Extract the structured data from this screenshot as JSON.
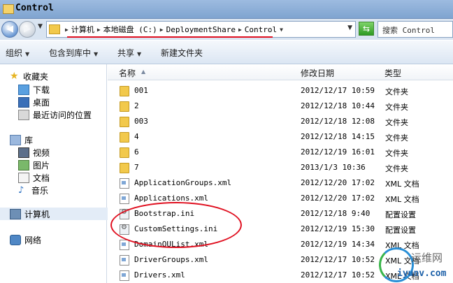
{
  "window": {
    "title": "Control"
  },
  "address": {
    "crumbs": [
      "计算机",
      "本地磁盘 (C:)",
      "DeploymentShare",
      "Control"
    ],
    "search_placeholder": "搜索 Control"
  },
  "toolbar": {
    "organize": "组织",
    "include_library": "包含到库中",
    "share": "共享",
    "new_folder": "新建文件夹"
  },
  "nav": {
    "favorites": {
      "label": "收藏夹",
      "items": [
        "下载",
        "桌面",
        "最近访问的位置"
      ]
    },
    "libraries": {
      "label": "库",
      "items": [
        "视频",
        "图片",
        "文档",
        "音乐"
      ]
    },
    "computer": "计算机",
    "network": "网络"
  },
  "columns": {
    "name": "名称",
    "date": "修改日期",
    "type": "类型"
  },
  "files": [
    {
      "name": "001",
      "date": "2012/12/17 10:59",
      "type": "文件夹",
      "icon": "folder-icon"
    },
    {
      "name": "2",
      "date": "2012/12/18 10:44",
      "type": "文件夹",
      "icon": "folder-icon"
    },
    {
      "name": "003",
      "date": "2012/12/18 12:08",
      "type": "文件夹",
      "icon": "folder-icon"
    },
    {
      "name": "4",
      "date": "2012/12/18 14:15",
      "type": "文件夹",
      "icon": "folder-icon"
    },
    {
      "name": "6",
      "date": "2012/12/19 16:01",
      "type": "文件夹",
      "icon": "folder-icon"
    },
    {
      "name": "7",
      "date": "2013/1/3 10:36",
      "type": "文件夹",
      "icon": "folder-icon"
    },
    {
      "name": "ApplicationGroups.xml",
      "date": "2012/12/20 17:02",
      "type": "XML 文档",
      "icon": "xml-file-icon"
    },
    {
      "name": "Applications.xml",
      "date": "2012/12/20 17:02",
      "type": "XML 文档",
      "icon": "xml-file-icon"
    },
    {
      "name": "Bootstrap.ini",
      "date": "2012/12/18 9:40",
      "type": "配置设置",
      "icon": "ini-file-icon"
    },
    {
      "name": "CustomSettings.ini",
      "date": "2012/12/19 15:30",
      "type": "配置设置",
      "icon": "ini-file-icon"
    },
    {
      "name": "DomainOUList.xml",
      "date": "2012/12/19 14:34",
      "type": "XML 文档",
      "icon": "xml-file-icon"
    },
    {
      "name": "DriverGroups.xml",
      "date": "2012/12/17 10:52",
      "type": "XML 文档",
      "icon": "xml-file-icon"
    },
    {
      "name": "Drivers.xml",
      "date": "2012/12/17 10:52",
      "type": "XML 文档",
      "icon": "xml-file-icon"
    }
  ],
  "watermark": {
    "line1": "运维网",
    "line2": "iyunv.com"
  }
}
